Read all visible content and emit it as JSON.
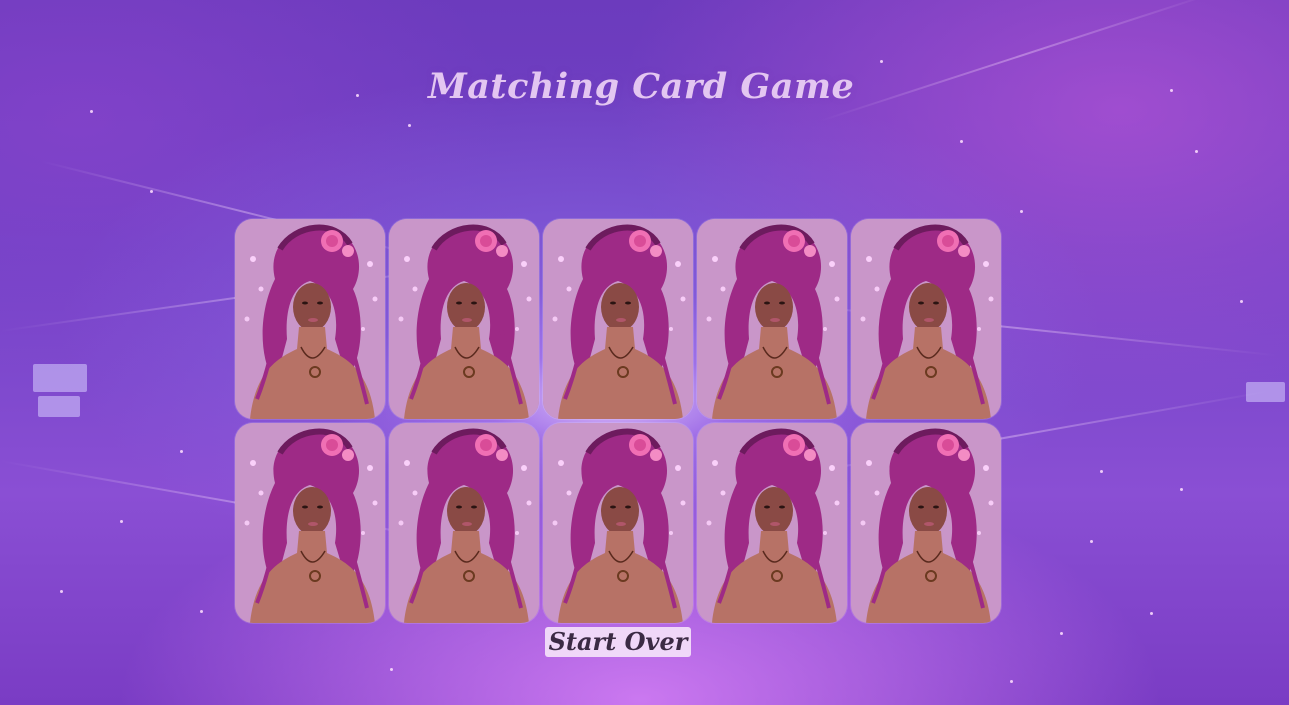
{
  "game": {
    "title": "Matching Card Game",
    "card_back_image": "portrait-woman-pink-dreadlocks-roses",
    "cards": [
      {
        "state": "face-down"
      },
      {
        "state": "face-down"
      },
      {
        "state": "face-down"
      },
      {
        "state": "face-down"
      },
      {
        "state": "face-down"
      },
      {
        "state": "face-down"
      },
      {
        "state": "face-down"
      },
      {
        "state": "face-down"
      },
      {
        "state": "face-down"
      },
      {
        "state": "face-down"
      }
    ],
    "grid": {
      "rows": 2,
      "columns": 5
    },
    "start_over_label": "Start Over"
  },
  "colors": {
    "background": "#7142c6",
    "title_text": "#e3c6f1",
    "button_background": "#f4e1fa",
    "button_text": "#3b2a44",
    "card_hair": "#9e2a86",
    "card_skin": "#8a4a45",
    "card_rose": "#f06fb4"
  }
}
